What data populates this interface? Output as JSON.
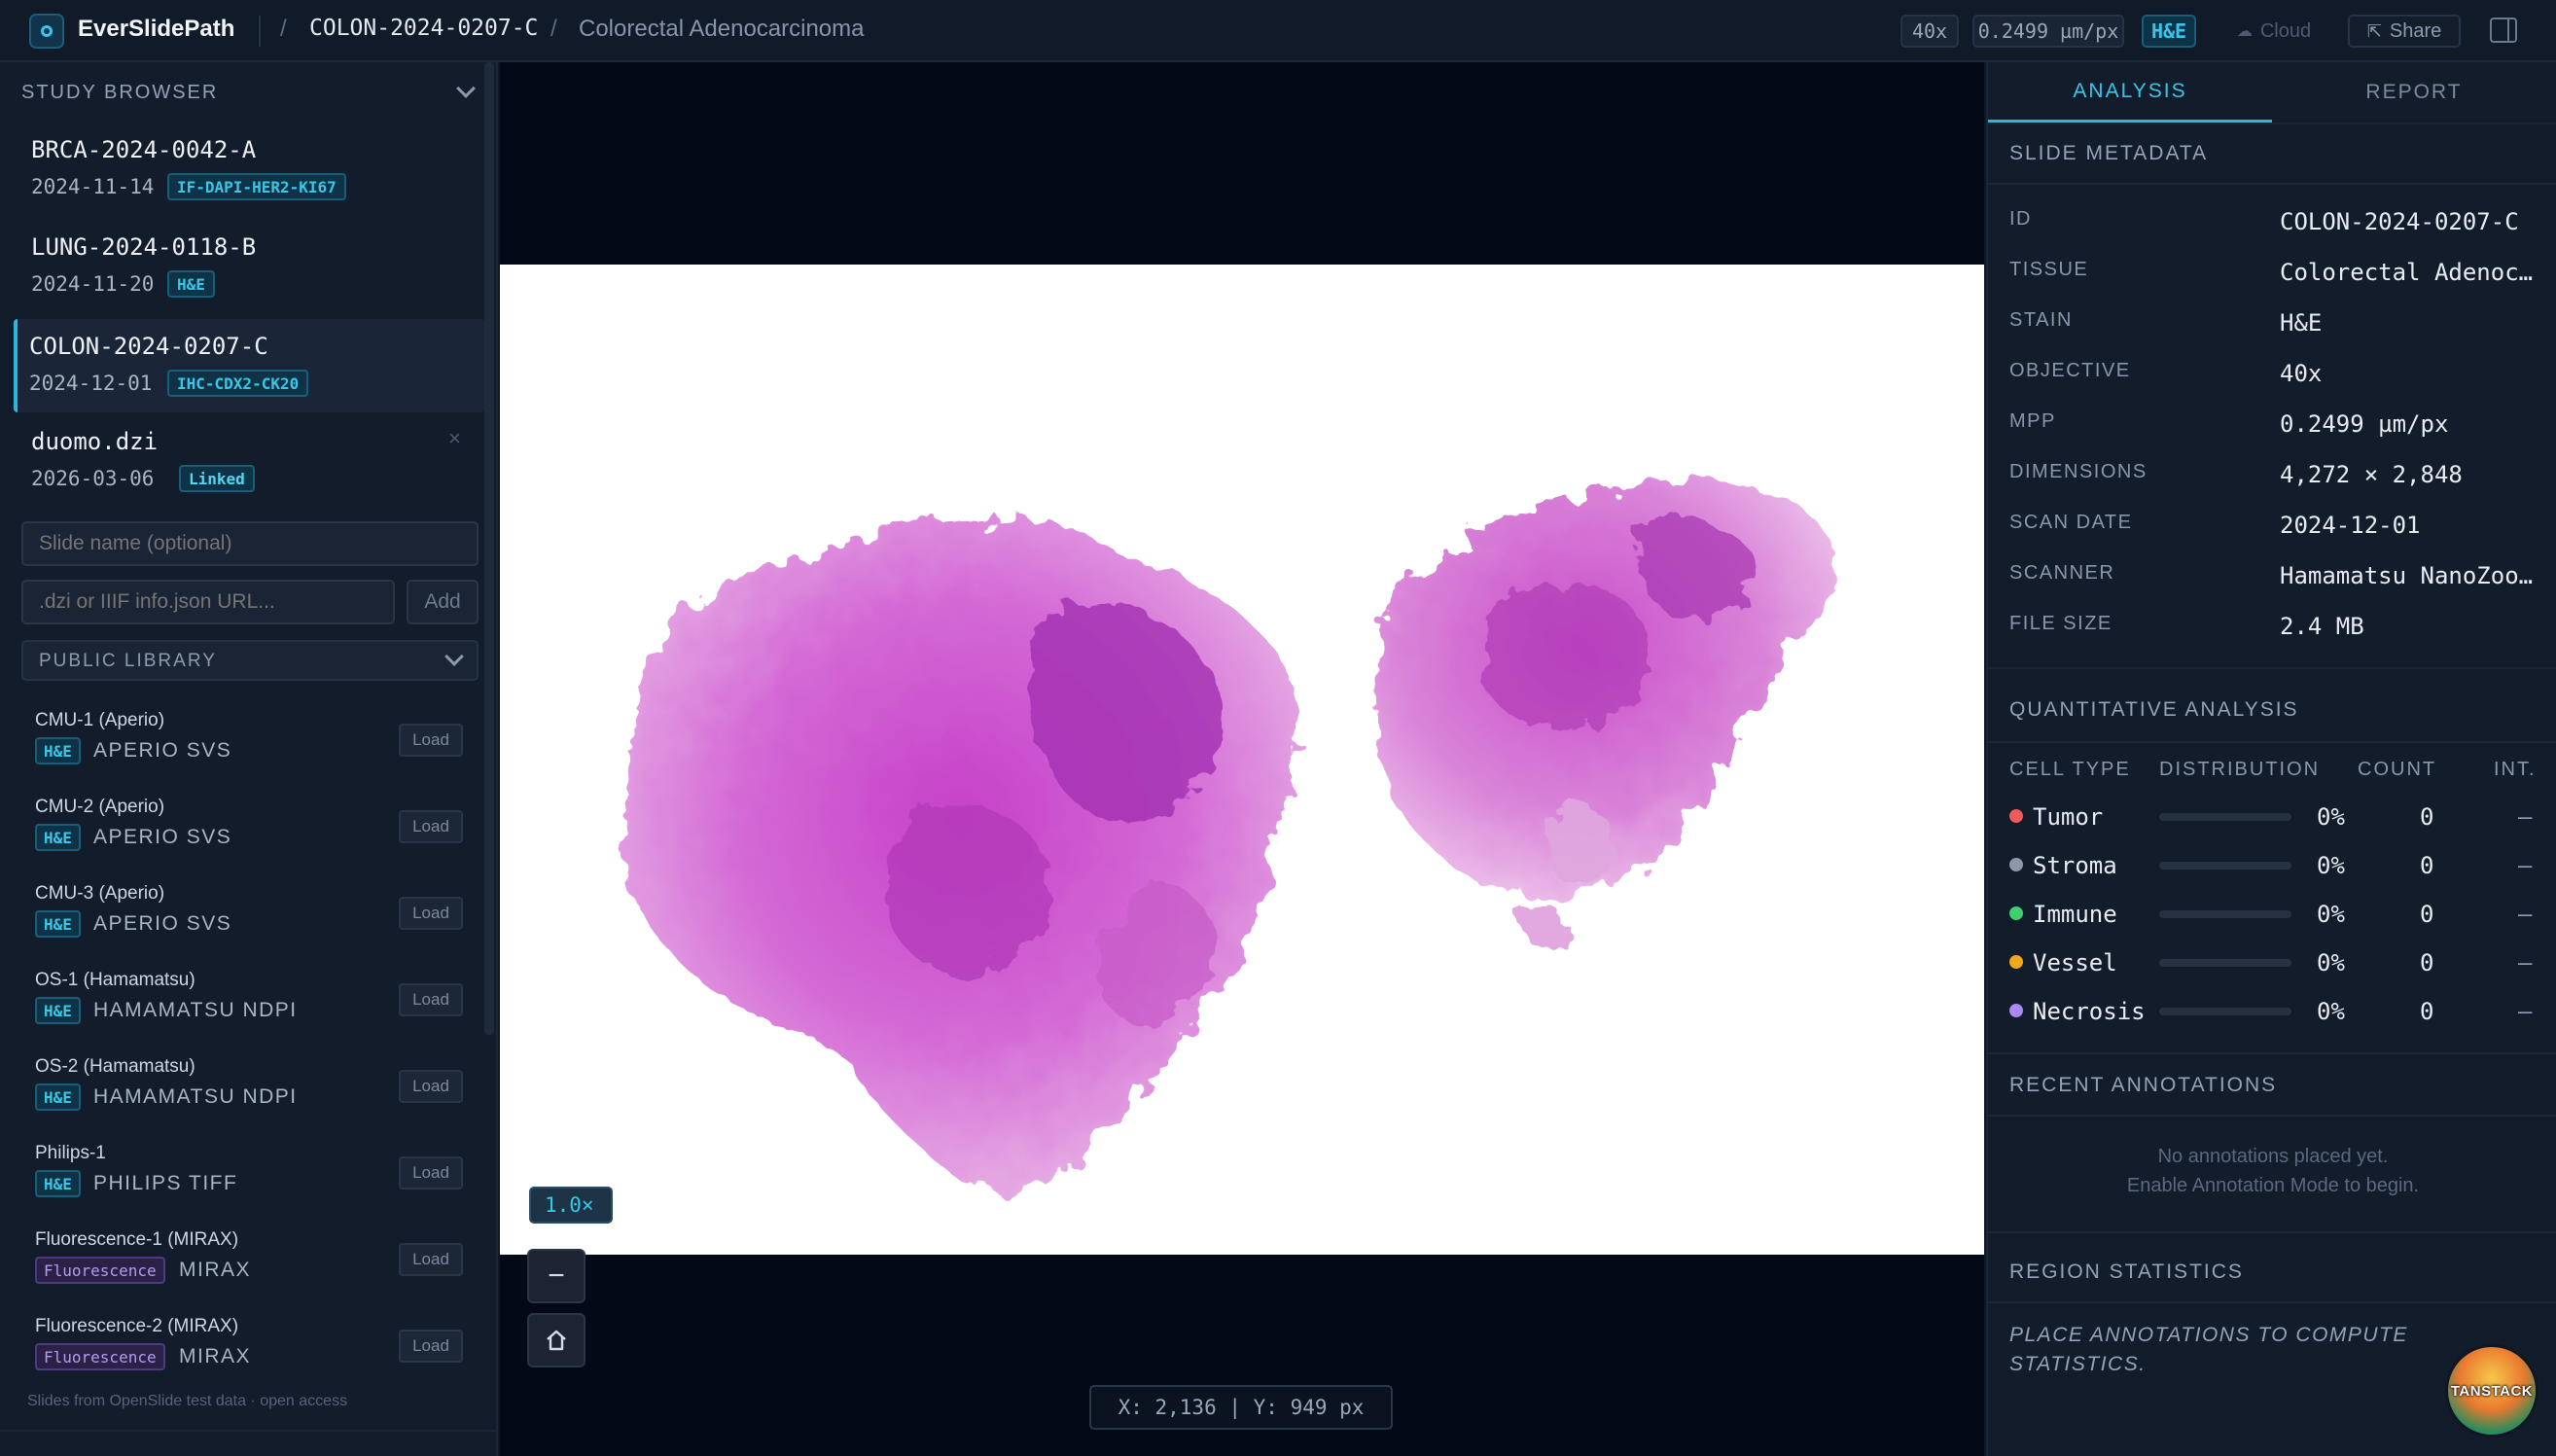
{
  "app": {
    "title": "EverSlidePath"
  },
  "breadcrumb": {
    "slide_id": "COLON-2024-0207-C",
    "tissue": "Colorectal Adenocarcinoma",
    "sep": "/"
  },
  "toolbar": {
    "objective": "40x",
    "mpp": "0.2499 µm/px",
    "stain": "H&E",
    "cloud_label": "Cloud",
    "share_label": "Share"
  },
  "sidebar": {
    "study_browser_title": "STUDY BROWSER",
    "studies": [
      {
        "name": "BRCA-2024-0042-A",
        "date": "2024-11-14",
        "tag": "IF-DAPI-HER2-KI67"
      },
      {
        "name": "LUNG-2024-0118-B",
        "date": "2024-11-20",
        "tag": "H&E"
      },
      {
        "name": "COLON-2024-0207-C",
        "date": "2024-12-01",
        "tag": "IHC-CDX2-CK20"
      },
      {
        "name": "duomo.dzi",
        "date": "2026-03-06",
        "tag": "Linked",
        "close": "×"
      }
    ],
    "slide_name_placeholder": "Slide name (optional)",
    "url_placeholder": ".dzi or IIIF info.json URL...",
    "add_label": "Add",
    "library_label": "PUBLIC LIBRARY",
    "load_label": "Load",
    "library": [
      {
        "name": "CMU-1 (Aperio)",
        "tag": "H&E",
        "format": "APERIO SVS"
      },
      {
        "name": "CMU-2 (Aperio)",
        "tag": "H&E",
        "format": "APERIO SVS"
      },
      {
        "name": "CMU-3 (Aperio)",
        "tag": "H&E",
        "format": "APERIO SVS"
      },
      {
        "name": "OS-1 (Hamamatsu)",
        "tag": "H&E",
        "format": "HAMAMATSU NDPI"
      },
      {
        "name": "OS-2 (Hamamatsu)",
        "tag": "H&E",
        "format": "HAMAMATSU NDPI"
      },
      {
        "name": "Philips-1",
        "tag": "H&E",
        "format": "PHILIPS TIFF"
      },
      {
        "name": "Fluorescence-1 (MIRAX)",
        "tag": "Fluorescence",
        "format": "MIRAX"
      },
      {
        "name": "Fluorescence-2 (MIRAX)",
        "tag": "Fluorescence",
        "format": "MIRAX"
      }
    ],
    "footer_note": "Slides from OpenSlide test data · open access"
  },
  "viewer": {
    "zoom": "1.0×",
    "zoom_out": "−",
    "coords": "X: 2,136 | Y: 949 px"
  },
  "panel": {
    "tabs": [
      {
        "label": "ANALYSIS"
      },
      {
        "label": "REPORT"
      }
    ],
    "metadata_title": "SLIDE METADATA",
    "metadata": [
      {
        "key": "ID",
        "value": "COLON-2024-0207-C"
      },
      {
        "key": "TISSUE",
        "value": "Colorectal Adenoc…"
      },
      {
        "key": "STAIN",
        "value": "H&E"
      },
      {
        "key": "OBJECTIVE",
        "value": "40x"
      },
      {
        "key": "MPP",
        "value": "0.2499 µm/px"
      },
      {
        "key": "DIMENSIONS",
        "value": "4,272 × 2,848"
      },
      {
        "key": "SCAN DATE",
        "value": "2024-12-01"
      },
      {
        "key": "SCANNER",
        "value": "Hamamatsu NanoZoo…"
      },
      {
        "key": "FILE SIZE",
        "value": "2.4 MB"
      }
    ],
    "quant_title": "QUANTITATIVE ANALYSIS",
    "quant_headers": {
      "cell_type": "CELL TYPE",
      "distribution": "DISTRIBUTION",
      "count": "COUNT",
      "int": "INT."
    },
    "cells": [
      {
        "name": "Tumor",
        "color": "#ef5b5b",
        "pct": "0%",
        "count": "0",
        "int": "—"
      },
      {
        "name": "Stroma",
        "color": "#8d97a8",
        "pct": "0%",
        "count": "0",
        "int": "—"
      },
      {
        "name": "Immune",
        "color": "#3fcf6e",
        "pct": "0%",
        "count": "0",
        "int": "—"
      },
      {
        "name": "Vessel",
        "color": "#f2a81d",
        "pct": "0%",
        "count": "0",
        "int": "—"
      },
      {
        "name": "Necrosis",
        "color": "#a98af0",
        "pct": "0%",
        "count": "0",
        "int": "—"
      }
    ],
    "annotations_title": "RECENT ANNOTATIONS",
    "annotations_empty_1": "No annotations placed yet.",
    "annotations_empty_2": "Enable Annotation Mode to begin.",
    "region_title": "REGION STATISTICS",
    "region_note": "PLACE ANNOTATIONS TO COMPUTE STATISTICS.",
    "badge": "TANSTACK"
  }
}
